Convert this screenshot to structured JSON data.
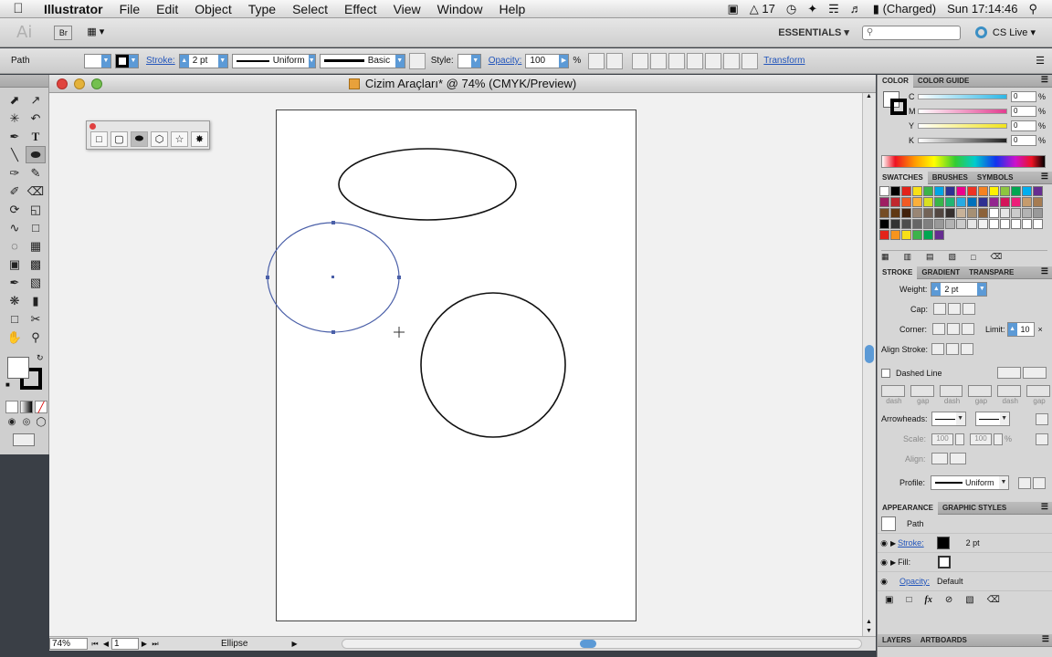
{
  "menubar": {
    "app": "Illustrator",
    "items": [
      "File",
      "Edit",
      "Object",
      "Type",
      "Select",
      "Effect",
      "View",
      "Window",
      "Help"
    ],
    "status": {
      "ai_count": "17",
      "battery": "(Charged)",
      "clock": "Sun 17:14:46"
    }
  },
  "appbar": {
    "bridge": "Br",
    "workspace": "ESSENTIALS ▾",
    "search_placeholder": "",
    "cslive": "CS Live ▾"
  },
  "control": {
    "selection": "Path",
    "stroke_label": "Stroke:",
    "stroke_weight": "2 pt",
    "profile": "Uniform",
    "brush": "Basic",
    "style_label": "Style:",
    "opacity_label": "Opacity:",
    "opacity": "100",
    "pct": "%",
    "transform": "Transform"
  },
  "document": {
    "title": "Cizim Araçları* @ 74% (CMYK/Preview)"
  },
  "statusbar": {
    "zoom": "74%",
    "page": "1",
    "info": "Ellipse"
  },
  "color_panel": {
    "tabs": [
      "COLOR",
      "COLOR GUIDE"
    ],
    "channels": [
      {
        "name": "C",
        "value": "0",
        "color": "#2db7e6"
      },
      {
        "name": "M",
        "value": "0",
        "color": "#e23d8f"
      },
      {
        "name": "Y",
        "value": "0",
        "color": "#f1e31c"
      },
      {
        "name": "K",
        "value": "0",
        "color": "#222222"
      }
    ],
    "pct": "%"
  },
  "swatches_panel": {
    "tabs": [
      "SWATCHES",
      "BRUSHES",
      "SYMBOLS"
    ]
  },
  "stroke_panel": {
    "tabs": [
      "STROKE",
      "GRADIENT",
      "TRANSPARE"
    ],
    "weight_label": "Weight:",
    "weight": "2 pt",
    "cap_label": "Cap:",
    "corner_label": "Corner:",
    "limit_label": "Limit:",
    "limit": "10",
    "align_label": "Align Stroke:",
    "dashed_label": "Dashed Line",
    "dash_labels": [
      "dash",
      "gap",
      "dash",
      "gap",
      "dash",
      "gap"
    ],
    "arrowheads_label": "Arrowheads:",
    "scale_label": "Scale:",
    "scale1": "100",
    "scale2": "100",
    "align2_label": "Align:",
    "profile_label": "Profile:",
    "profile": "Uniform"
  },
  "appearance_panel": {
    "tabs": [
      "APPEARANCE",
      "GRAPHIC STYLES"
    ],
    "object": "Path",
    "stroke_label": "Stroke:",
    "stroke_value": "2 pt",
    "fill_label": "Fill:",
    "opacity_label": "Opacity:",
    "opacity_value": "Default"
  },
  "layers_panel": {
    "tabs": [
      "LAYERS",
      "ARTBOARDS"
    ]
  }
}
